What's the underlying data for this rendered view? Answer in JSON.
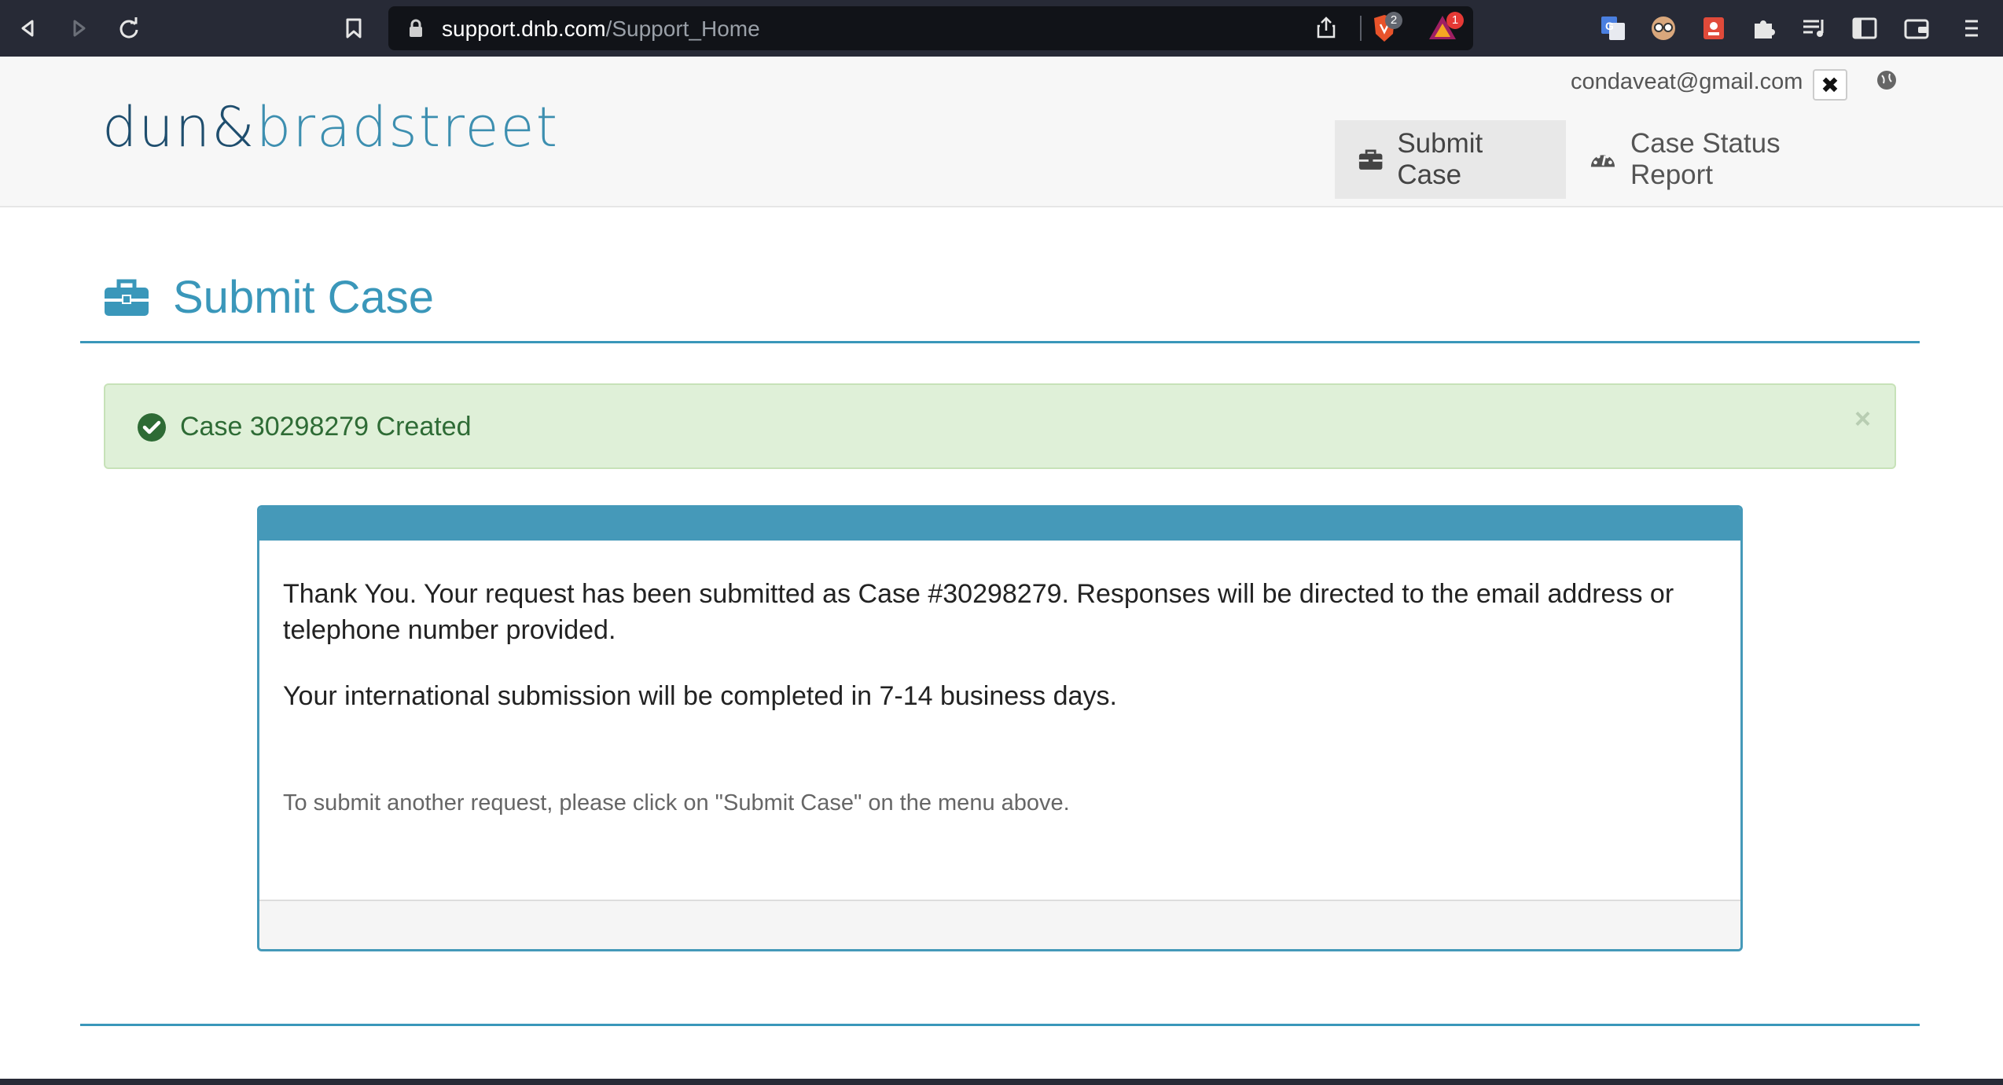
{
  "browser": {
    "url_domain": "support.dnb.com",
    "url_path": "/Support_Home",
    "brave_shield_count": "2",
    "rewards_count": "1"
  },
  "header": {
    "logo_dun": "dun",
    "logo_amp": "&",
    "logo_rest": "bradstreet",
    "user_email": "condaveat@gmail.com",
    "logout_symbol": "✖",
    "nav": {
      "submit_case": "Submit Case",
      "case_status_report": "Case Status Report"
    }
  },
  "main": {
    "page_title": "Submit Case",
    "alert": {
      "text": "Case 30298279 Created",
      "close": "×"
    },
    "panel": {
      "message": "Thank You.  Your request has been submitted as Case #30298279. Responses will be directed to the email address or telephone number provided.",
      "international": "Your international submission will be completed in 7-14 business days.",
      "note": "To submit another request, please click on \"Submit Case\" on the menu above."
    }
  },
  "colors": {
    "brand_blue": "#3a97ba",
    "panel_header": "#4599b9",
    "success_bg": "#dff0d8",
    "success_text": "#2e6b35",
    "chrome_bg": "#272a36"
  }
}
